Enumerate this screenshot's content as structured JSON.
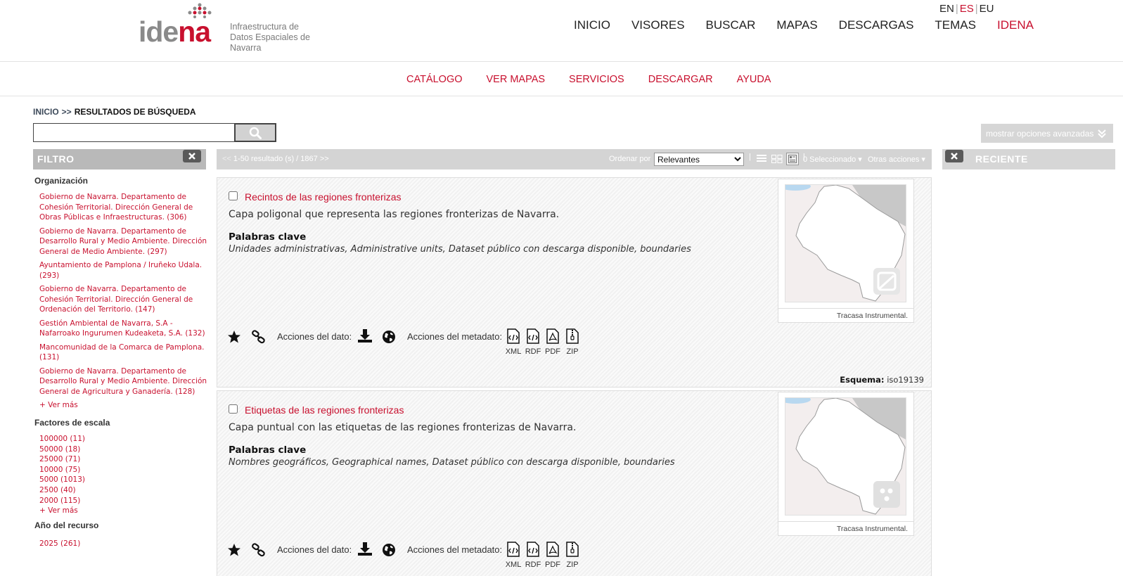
{
  "logo": {
    "text_gray": "ide",
    "text_red": "na",
    "subtitle_line1": "Infraestructura de",
    "subtitle_line2": "Datos Espaciales de Navarra"
  },
  "languages": [
    {
      "code": "EN"
    },
    {
      "code": "ES",
      "active": true
    },
    {
      "code": "EU"
    }
  ],
  "main_nav": [
    "INICIO",
    "VISORES",
    "BUSCAR",
    "MAPAS",
    "DESCARGAS",
    "TEMAS",
    "IDENA"
  ],
  "sub_nav": [
    "CATÁLOGO",
    "VER MAPAS",
    "SERVICIOS",
    "DESCARGAR",
    "AYUDA"
  ],
  "breadcrumb": {
    "home": "INICIO",
    "sep": ">>",
    "current": "RESULTADOS DE BÚSQUEDA"
  },
  "search": {
    "value": "",
    "placeholder": ""
  },
  "advanced_label": "mostrar opciones avanzadas",
  "filter": {
    "title": "FILTRO",
    "organizacion": {
      "title": "Organización",
      "items": [
        "Gobierno de Navarra. Departamento de Cohesión Territorial. Dirección General de Obras Públicas e Infraestructuras. (306)",
        "Gobierno de Navarra. Departamento de Desarrollo Rural y Medio Ambiente. Dirección General de Medio Ambiente. (297)",
        "Ayuntamiento de Pamplona / Iruñeko Udala. (293)",
        "Gobierno de Navarra. Departamento de Cohesión Territorial. Dirección General de Ordenación del Territorio. (147)",
        "Gestión Ambiental de Navarra, S.A - Nafarroako Ingurumen Kudeaketa, S.A. (132)",
        "Mancomunidad de la Comarca de Pamplona. (131)",
        "Gobierno de Navarra. Departamento de Desarrollo Rural y Medio Ambiente. Dirección General de Agricultura y Ganadería. (128)"
      ],
      "more": "+ Ver más"
    },
    "escala": {
      "title": "Factores de escala",
      "items": [
        "100000 (11)",
        "50000 (18)",
        "25000 (71)",
        "10000 (75)",
        "5000 (1013)",
        "2500 (40)",
        "2000 (115)"
      ],
      "more": "+ Ver más"
    },
    "anio": {
      "title": "Año del recurso",
      "items": [
        "2025 (261)"
      ]
    }
  },
  "results_toolbar": {
    "prev": "<<",
    "count": "1-50 resultado (s) / 1867",
    "next": ">>",
    "order_label": "Ordenar por",
    "order_value": "Relevantes",
    "selected": "0 Seleccionado",
    "other_actions": "Otras acciones"
  },
  "recent": {
    "title": "RECIENTE"
  },
  "results": [
    {
      "title": "Recintos de las regiones fronterizas",
      "description": "Capa poligonal que representa las regiones fronterizas de Navarra.",
      "keywords_title": "Palabras clave",
      "keywords": "Unidades administrativas, Administrative units, Dataset público con descarga disponible, boundaries",
      "credit": "Tracasa Instrumental.",
      "data_actions_label": "Acciones del dato:",
      "metadata_actions_label": "Acciones del metadato:",
      "formats": [
        "XML",
        "RDF",
        "PDF",
        "ZIP"
      ],
      "schema_label": "Esquema:",
      "schema_value": "iso19139",
      "badge": "polygon-icon"
    },
    {
      "title": "Etiquetas de las regiones fronterizas",
      "description": "Capa puntual con las etiquetas de las regiones fronterizas de Navarra.",
      "keywords_title": "Palabras clave",
      "keywords": "Nombres geográficos, Geographical names, Dataset público con descarga disponible, boundaries",
      "credit": "Tracasa Instrumental.",
      "data_actions_label": "Acciones del dato:",
      "metadata_actions_label": "Acciones del metadato:",
      "formats": [
        "XML",
        "RDF",
        "PDF",
        "ZIP"
      ],
      "badge": "points-icon"
    }
  ],
  "colors": {
    "brand_red": "#c8102e",
    "gray_bar": "#d4d4d4"
  }
}
